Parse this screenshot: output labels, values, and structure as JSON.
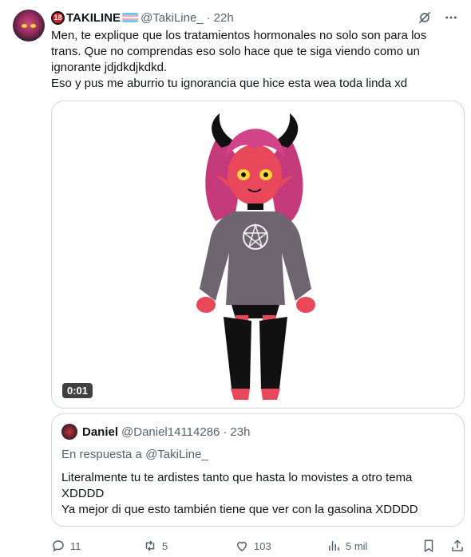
{
  "author": {
    "badge": "18",
    "name": "TAKILINE",
    "handle": "@TakiLine_",
    "time": "22h"
  },
  "tweet": {
    "lines": [
      "Men, te explique que los tratamientos hormonales no solo son para los",
      "trans. Que no comprendas eso solo hace que te siga viendo como un",
      "ignorante jdjdkdjkdkd.",
      "Eso y pus me aburrio tu ignorancia que hice esta wea toda linda xd"
    ]
  },
  "media": {
    "duration": "0:01"
  },
  "quote": {
    "name": "Daniel",
    "handle": "@Daniel14114286",
    "time": "23h",
    "reply_to": "En respuesta a @TakiLine_",
    "lines": [
      "Literalmente tu te ardistes tanto que hasta lo movistes a otro tema",
      "XDDDD",
      "Ya mejor di que esto también tiene que ver con la gasolina XDDDD"
    ]
  },
  "actions": {
    "replies": "11",
    "retweets": "5",
    "likes": "103",
    "views": "5 mil"
  }
}
